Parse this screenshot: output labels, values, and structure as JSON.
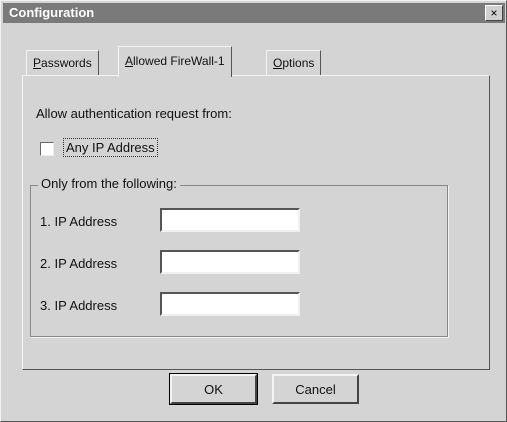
{
  "window": {
    "title": "Configuration",
    "close_glyph": "×"
  },
  "tabs": [
    {
      "label": "Passwords",
      "mnemonic": "P",
      "rest": "asswords",
      "active": false
    },
    {
      "label": "Allowed FireWall-1",
      "mnemonic": "A",
      "rest": "llowed FireWall-1",
      "active": true
    },
    {
      "label": "Options",
      "mnemonic": "O",
      "rest": "ptions",
      "active": false
    }
  ],
  "panel": {
    "heading": "Allow authentication request from:",
    "any_ip": {
      "label": "Any IP Address",
      "checked": false
    },
    "group_label": "Only from the following:",
    "ip_fields": [
      {
        "label": "1. IP Address",
        "value": ""
      },
      {
        "label": "2. IP Address",
        "value": ""
      },
      {
        "label": "3. IP Address",
        "value": ""
      }
    ]
  },
  "buttons": {
    "ok": "OK",
    "cancel": "Cancel"
  }
}
